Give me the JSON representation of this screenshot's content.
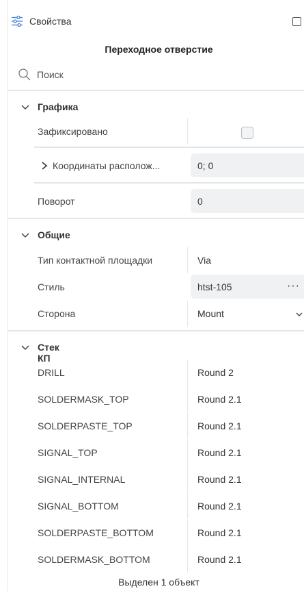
{
  "header": {
    "title": "Свойства",
    "icon": "sliders-icon",
    "window_icon": "window-square-icon"
  },
  "subtitle": "Переходное отверстие",
  "search": {
    "label": "Поиск",
    "icon": "search-icon"
  },
  "sections": {
    "graphics": {
      "title": "Графика",
      "fixed": {
        "label": "Зафиксировано",
        "checked": false
      },
      "coords": {
        "label": "Координаты располож...",
        "value": "0; 0"
      },
      "rotation": {
        "label": "Поворот",
        "value": "0"
      }
    },
    "general": {
      "title": "Общие",
      "pad_type": {
        "label": "Тип контактной площадки",
        "value": "Via"
      },
      "style": {
        "label": "Стиль",
        "value": "htst-105",
        "more": "···"
      },
      "side": {
        "label": "Сторона",
        "value": "Mount"
      }
    },
    "stack": {
      "title": "Стек КП",
      "rows": [
        {
          "label": "DRILL",
          "value": "Round 2"
        },
        {
          "label": "SOLDERMASK_TOP",
          "value": "Round 2.1"
        },
        {
          "label": "SOLDERPASTE_TOP",
          "value": "Round 2.1"
        },
        {
          "label": "SIGNAL_TOP",
          "value": "Round 2.1"
        },
        {
          "label": "SIGNAL_INTERNAL",
          "value": "Round 2.1"
        },
        {
          "label": "SIGNAL_BOTTOM",
          "value": "Round 2.1"
        },
        {
          "label": "SOLDERPASTE_BOTTOM",
          "value": "Round 2.1"
        },
        {
          "label": "SOLDERMASK_BOTTOM",
          "value": "Round 2.1"
        }
      ]
    }
  },
  "footer": "Выделен 1 объект"
}
